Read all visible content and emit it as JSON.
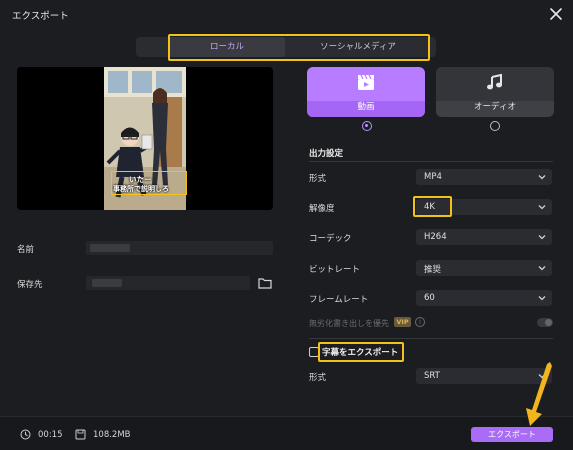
{
  "window": {
    "title": "エクスポート"
  },
  "tabs": [
    {
      "label": "ローカル",
      "active": true
    },
    {
      "label": "ソーシャルメディア",
      "active": false
    }
  ],
  "preview": {
    "caption_line1": "いたー",
    "caption_line2": "事務所で説明しろ"
  },
  "file": {
    "name_label": "名前",
    "save_label": "保存先"
  },
  "modes": [
    {
      "label": "動画",
      "icon": "clapper-video-icon",
      "selected": true
    },
    {
      "label": "オーディオ",
      "icon": "music-note-icon",
      "selected": false
    }
  ],
  "settings": {
    "section_title": "出力設定",
    "rows": [
      {
        "label": "形式",
        "value": "MP4"
      },
      {
        "label": "解像度",
        "value": "4K"
      },
      {
        "label": "コーデック",
        "value": "H264"
      },
      {
        "label": "ビットレート",
        "value": "推奨"
      },
      {
        "label": "フレームレート",
        "value": "60"
      }
    ],
    "disabled_option": "無劣化書き出しを優先",
    "vip_badge": "VIP",
    "subtitle_export_label": "字幕をエクスポート",
    "subtitle_format_label": "形式",
    "subtitle_format_value": "SRT"
  },
  "footer": {
    "duration": "00:15",
    "size": "108.2MB",
    "export_button": "エクスポート"
  },
  "colors": {
    "accent": "#b77cff",
    "highlight": "#f2c21b",
    "background": "#1c1d21"
  }
}
